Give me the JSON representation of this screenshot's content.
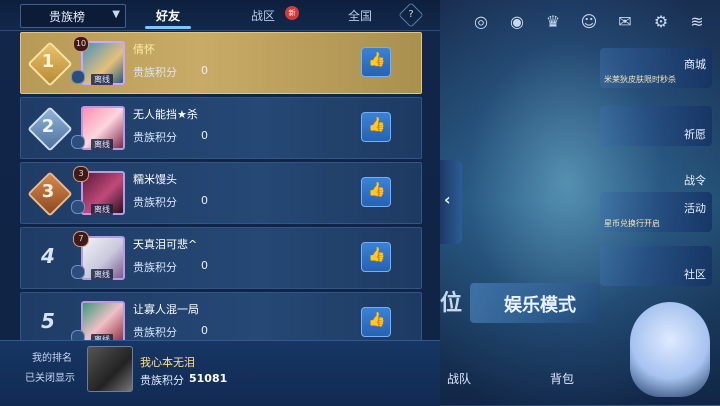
{
  "tabs": {
    "dropdown_label": "贵族榜",
    "friends": "好友",
    "zone": "战区",
    "zone_badge": "新",
    "global": "全国",
    "help": "?"
  },
  "rows": [
    {
      "rank": "1",
      "level": "10",
      "name": "倩怀",
      "offline": "离线",
      "score_label": "贵族积分",
      "score": "0"
    },
    {
      "rank": "2",
      "level": "",
      "name": "无人能挡★杀",
      "offline": "离线",
      "score_label": "贵族积分",
      "score": "0"
    },
    {
      "rank": "3",
      "level": "3",
      "name": "糯米馒头",
      "offline": "离线",
      "score_label": "贵族积分",
      "score": "0"
    },
    {
      "rank": "4",
      "level": "7",
      "name": "天真泪可悲^",
      "offline": "离线",
      "score_label": "贵族积分",
      "score": "0"
    },
    {
      "rank": "5",
      "level": "",
      "name": "让寡人混一局",
      "offline": "离线",
      "score_label": "贵族积分",
      "score": "0"
    }
  ],
  "my_rank": {
    "title": "我的排名",
    "status": "已关闭显示",
    "name": "我心本无泪",
    "score_label": "贵族积分",
    "score": "51081"
  },
  "right_menu": {
    "shop_sub": "米莱狄皮肤限时秒杀",
    "shop": "商城",
    "pray": "祈愿",
    "battle_pass": "战令",
    "event_sub": "星币兑换行开启",
    "event": "活动",
    "community": "社区"
  },
  "bottom": {
    "mode_left": "位",
    "mode": "娱乐模式",
    "team": "战队",
    "bag": "背包"
  },
  "colors": {
    "gold": "#c8ab66",
    "accent_blue": "#3a82d6",
    "badge_red": "#d43a3a"
  },
  "icons": [
    "target-icon",
    "eye-icon",
    "trophy-icon",
    "friends-icon",
    "mail-icon",
    "gear-icon",
    "wifi-icon",
    "thumbs-up-icon",
    "chevron-left-icon"
  ]
}
